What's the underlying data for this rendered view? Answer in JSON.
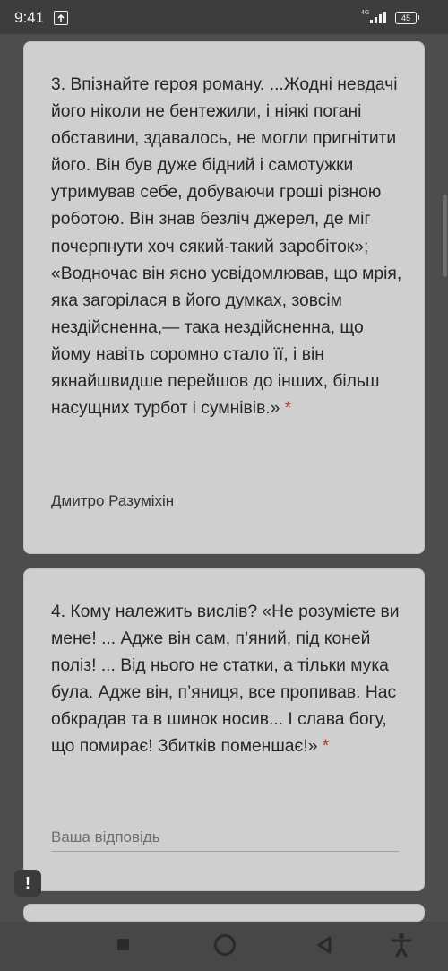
{
  "status_bar": {
    "time": "9:41",
    "network": "4G",
    "battery": "45"
  },
  "questions": [
    {
      "text": "3. Впізнайте героя роману. ...Жодні невдачі його ніколи не бентежили, і ніякі погані обставини, здавалось, не могли пригнітити його. Він був дуже бідний і самотужки утримував себе, добуваючи гроші різною роботою. Він знав безліч джерел, де міг почерпнути хоч сякий-такий заробіток»; «Водночас він ясно усвідомлював, що мрія, яка загорілася в його думках, зовсім нездійсненна,— така нездійсненна, що йому навіть соромно стало її, і він якнайшвидше перейшов до інших, більш насущних турбот і сумнівів.»",
      "required_mark": "*",
      "answer": "Дмитро Разуміхін"
    },
    {
      "text": "4. Кому належить вислів? «Не розумієте ви мене! ... Адже він сам, п’яний, під коней поліз! ... Від нього не статки, а тільки мука була. Адже він, п’яниця, все пропивав. Нас обкрадав та в шинок носив... І слава богу, що помирає! Збитків поменшає!»",
      "required_mark": "*",
      "placeholder": "Ваша відповідь"
    }
  ],
  "report_button": "!",
  "colors": {
    "background": "#4d4d4d",
    "card": "#cfcfcf",
    "required": "#b33a36",
    "text": "#262626"
  }
}
